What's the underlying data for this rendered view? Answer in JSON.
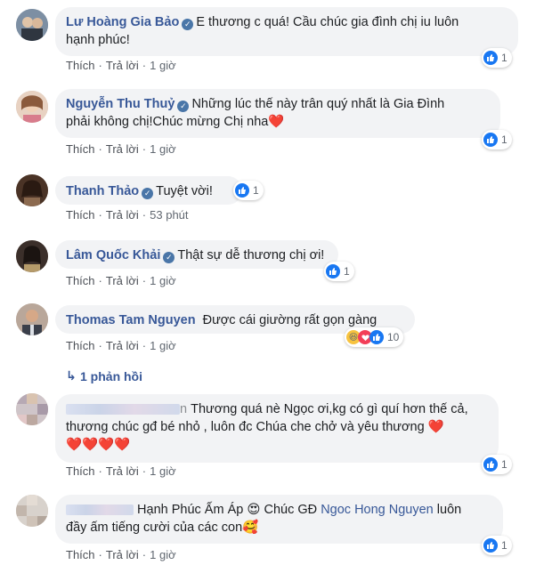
{
  "actions": {
    "like": "Thích",
    "reply": "Trả lời",
    "sep": "·"
  },
  "comments": [
    {
      "author": "Lư Hoàng Gia Bảo",
      "line1": "E thương c quá! Cầu chúc gia đình chị iu luôn",
      "line2": "hạnh phúc!",
      "time": "1 giờ",
      "likes": "1"
    },
    {
      "author": "Nguyễn Thu Thuỷ",
      "line1": "Những lúc thế này trân quý nhất là Gia Đình",
      "line2": "phải không chị!Chúc mừng Chị nha",
      "emoji": "❤️",
      "time": "1 giờ",
      "likes": "1"
    },
    {
      "author": "Thanh Thảo",
      "line1": "Tuyệt vời!",
      "time": "53 phút",
      "likes": "1"
    },
    {
      "author": "Lâm Quốc Khải",
      "line1": "Thật sự dễ thương chị ơi!",
      "time": "1 giờ",
      "likes": "1"
    },
    {
      "author": "Thomas Tam Nguyen",
      "line1": "Được cái giường rất gọn gàng",
      "time": "1 giờ",
      "likes": "10"
    },
    {
      "author_tail": "n",
      "line1": "Thương quá nè Ngọc ơi,kg có gì quí hơn thế cả,",
      "line2": "thương chúc gđ bé nhỏ , luôn đc Chúa che chở và yêu thương",
      "line3": "❤️❤️❤️❤️",
      "time": "1 giờ",
      "likes": "1"
    },
    {
      "line1_a": "Hạnh Phúc Ấm Áp",
      "emoji_a": "😍",
      "line1_b": "Chúc GĐ",
      "mention": "Ngoc Hong Nguyen",
      "line1_c": "luôn",
      "line2": "đầy ấm tiếng cười của các con",
      "emoji_b": "🥰",
      "time": "1 giờ",
      "likes": "1"
    }
  ],
  "replies_link": "1 phản hồi"
}
